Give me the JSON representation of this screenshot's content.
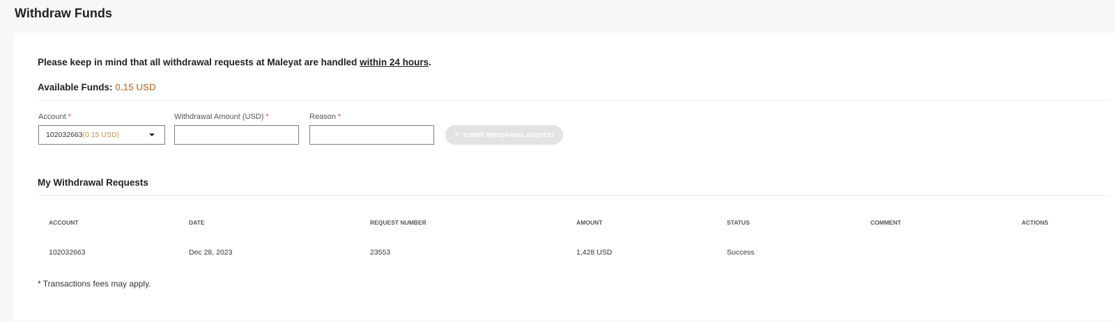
{
  "page": {
    "title": "Withdraw Funds"
  },
  "notice": {
    "text_before": "Please keep in mind that all withdrawal requests at Maleyat are handled ",
    "emphasis": "within 24 hours",
    "text_after": "."
  },
  "funds": {
    "label": "Available Funds:",
    "amount": "0.15 USD"
  },
  "form": {
    "account": {
      "label": "Account",
      "required_mark": "*",
      "selected_value": "102032663",
      "selected_balance": "(0.15 USD)"
    },
    "amount": {
      "label": "Withdrawal Amount (USD)",
      "required_mark": "*",
      "value": "",
      "placeholder": ""
    },
    "reason": {
      "label": "Reason",
      "required_mark": "*",
      "value": "",
      "placeholder": ""
    },
    "submit_label": "SUBMIT WITHDRAWAL REQUEST",
    "submit_icon": "check-icon"
  },
  "requests": {
    "title": "My Withdrawal Requests",
    "columns": [
      "ACCOUNT",
      "DATE",
      "REQUEST NUMBER",
      "AMOUNT",
      "STATUS",
      "COMMENT",
      "ACTIONS"
    ],
    "rows": [
      {
        "account": "102032663",
        "date": "Dec 28, 2023",
        "request_number": "23553",
        "amount": "1,428 USD",
        "status": "Success",
        "comment": "",
        "actions": ""
      }
    ]
  },
  "footnote": "* Transactions fees may apply.",
  "colors": {
    "accent": "#c5925c",
    "required": "#d9534f",
    "button_disabled": "#e3e3e3"
  }
}
